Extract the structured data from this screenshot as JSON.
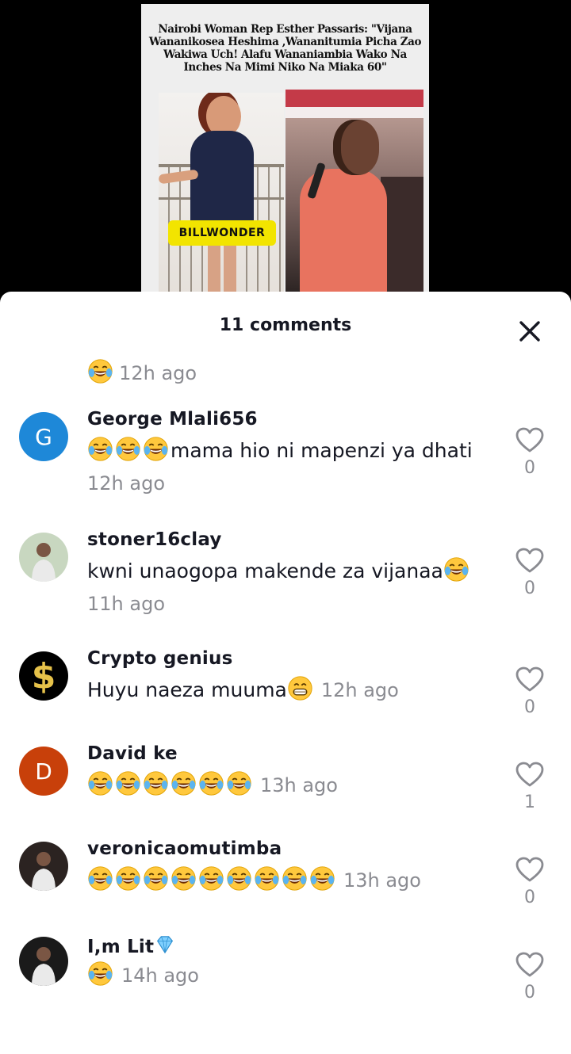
{
  "video": {
    "headline": "Nairobi Woman Rep Esther Passaris: \"Vijana Wananikosea Heshima ,Wananitumia Picha Zao Wakiwa Uch! Alafu Wananiambia Wako Na Inches Na Mimi Niko Na Miaka 60\"",
    "watermark": "BILLWONDER"
  },
  "sheet": {
    "title": "11 comments",
    "close_icon": "close-icon"
  },
  "partial_comment": {
    "text": "",
    "emoji_count": 1,
    "time": "12h ago"
  },
  "comments": [
    {
      "username": "George Mlali656",
      "avatar_letter": "G",
      "avatar_color": "#1e88d8",
      "emoji_prefix": 3,
      "text": "mama hio ni mapenzi ya dhati",
      "emoji_suffix": 0,
      "time": "12h ago",
      "likes": "0"
    },
    {
      "username": "stoner16clay",
      "avatar_letter": "",
      "avatar_color": "#c8d7c0",
      "emoji_prefix": 0,
      "text": "kwni unaogopa makende za vijanaa",
      "emoji_suffix": 1,
      "time": "11h ago",
      "likes": "0"
    },
    {
      "username": "Crypto genius",
      "avatar_letter": "$",
      "avatar_color": "#000000",
      "emoji_prefix": 0,
      "text": "Huyu naeza muuma",
      "emoji_suffix": 1,
      "time": "12h ago",
      "likes": "0"
    },
    {
      "username": "David ke",
      "avatar_letter": "D",
      "avatar_color": "#c8400a",
      "emoji_prefix": 6,
      "text": "",
      "emoji_suffix": 0,
      "time": "13h ago",
      "likes": "1"
    },
    {
      "username": "veronicaomutimba",
      "avatar_letter": "",
      "avatar_color": "#2b2321",
      "emoji_prefix": 9,
      "text": "",
      "emoji_suffix": 0,
      "time": "13h ago",
      "likes": "0"
    },
    {
      "username": "I,m Lit",
      "avatar_letter": "",
      "avatar_color": "#1a1a1a",
      "emoji_prefix": 1,
      "text": "",
      "emoji_suffix": 0,
      "time": "14h ago",
      "likes": "0"
    }
  ],
  "colors": {
    "text": "#161823",
    "muted": "#8a8b91",
    "emoji_face": "#ffc83d"
  }
}
